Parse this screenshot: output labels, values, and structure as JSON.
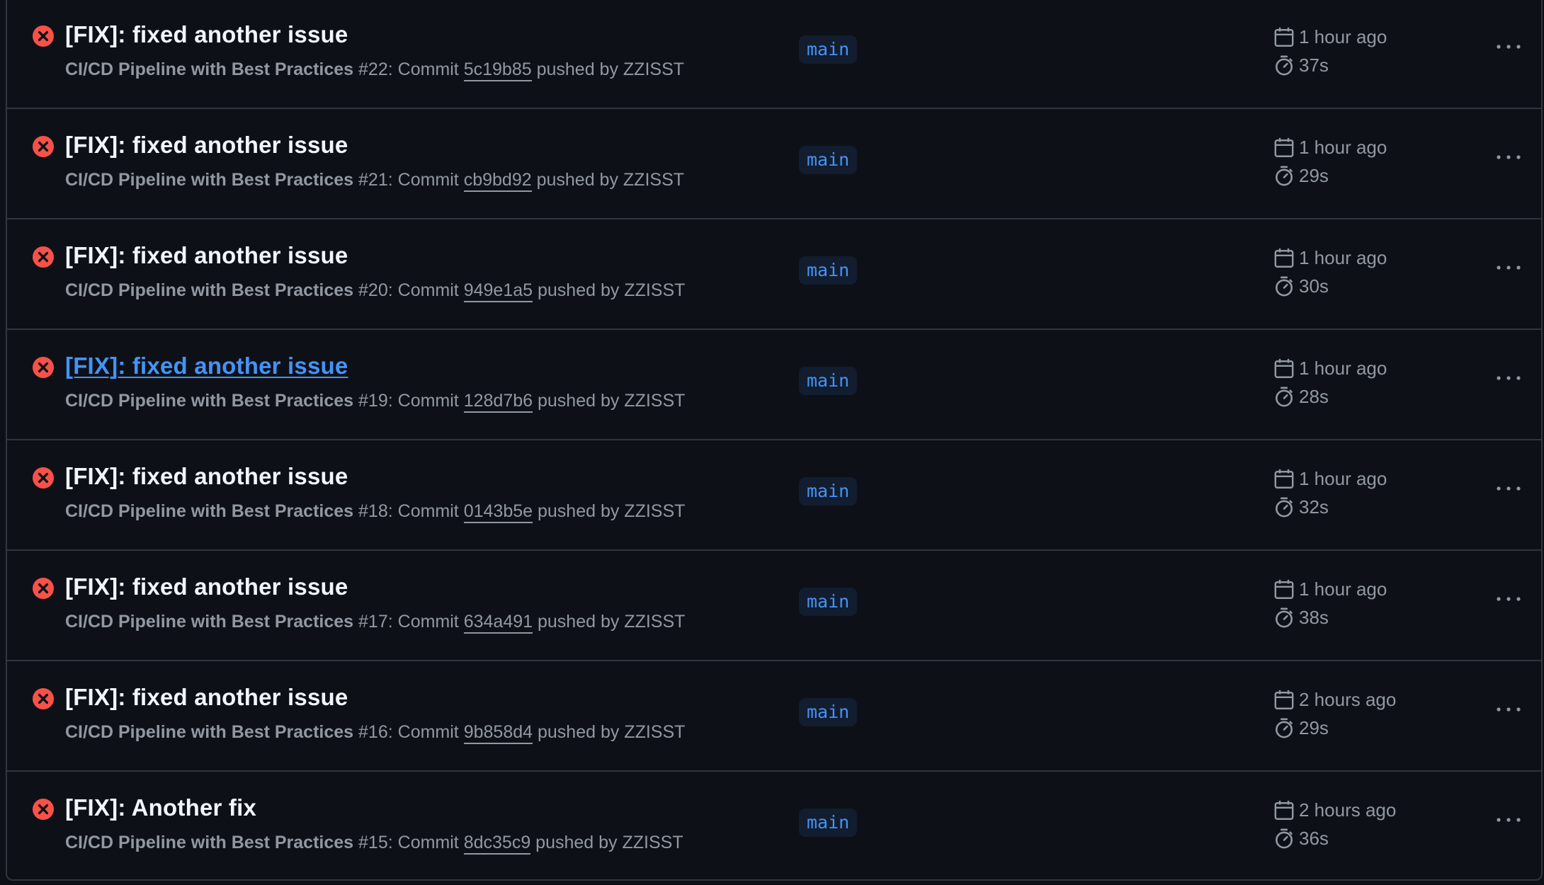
{
  "runs": [
    {
      "title": "[FIX]: fixed another issue",
      "workflow": "CI/CD Pipeline with Best Practices",
      "number": "#22",
      "commit_prefix": ": Commit ",
      "sha": "5c19b85",
      "pushed_by": " pushed by ZZISST",
      "branch": "main",
      "when": "1 hour ago",
      "duration": "37s",
      "status": "failure"
    },
    {
      "title": "[FIX]: fixed another issue",
      "workflow": "CI/CD Pipeline with Best Practices",
      "number": "#21",
      "commit_prefix": ": Commit ",
      "sha": "cb9bd92",
      "pushed_by": " pushed by ZZISST",
      "branch": "main",
      "when": "1 hour ago",
      "duration": "29s",
      "status": "failure"
    },
    {
      "title": "[FIX]: fixed another issue",
      "workflow": "CI/CD Pipeline with Best Practices",
      "number": "#20",
      "commit_prefix": ": Commit ",
      "sha": "949e1a5",
      "pushed_by": " pushed by ZZISST",
      "branch": "main",
      "when": "1 hour ago",
      "duration": "30s",
      "status": "failure"
    },
    {
      "title": "[FIX]: fixed another issue",
      "workflow": "CI/CD Pipeline with Best Practices",
      "number": "#19",
      "commit_prefix": ": Commit ",
      "sha": "128d7b6",
      "pushed_by": " pushed by ZZISST",
      "branch": "main",
      "when": "1 hour ago",
      "duration": "28s",
      "status": "failure"
    },
    {
      "title": "[FIX]: fixed another issue",
      "workflow": "CI/CD Pipeline with Best Practices",
      "number": "#18",
      "commit_prefix": ": Commit ",
      "sha": "0143b5e",
      "pushed_by": " pushed by ZZISST",
      "branch": "main",
      "when": "1 hour ago",
      "duration": "32s",
      "status": "failure"
    },
    {
      "title": "[FIX]: fixed another issue",
      "workflow": "CI/CD Pipeline with Best Practices",
      "number": "#17",
      "commit_prefix": ": Commit ",
      "sha": "634a491",
      "pushed_by": " pushed by ZZISST",
      "branch": "main",
      "when": "1 hour ago",
      "duration": "38s",
      "status": "failure"
    },
    {
      "title": "[FIX]: fixed another issue",
      "workflow": "CI/CD Pipeline with Best Practices",
      "number": "#16",
      "commit_prefix": ": Commit ",
      "sha": "9b858d4",
      "pushed_by": " pushed by ZZISST",
      "branch": "main",
      "when": "2 hours ago",
      "duration": "29s",
      "status": "failure"
    },
    {
      "title": "[FIX]: Another fix",
      "workflow": "CI/CD Pipeline with Best Practices",
      "number": "#15",
      "commit_prefix": ": Commit ",
      "sha": "8dc35c9",
      "pushed_by": " pushed by ZZISST",
      "branch": "main",
      "when": "2 hours ago",
      "duration": "36s",
      "status": "failure"
    }
  ],
  "hovered_run_index": 3,
  "icons": {
    "status": "x-circle-fill-icon",
    "date": "calendar-icon",
    "duration": "stopwatch-icon",
    "more": "kebab-horizontal-icon"
  },
  "colors": {
    "background": "#0d1117",
    "failure": "#f85149",
    "link": "#4493f8",
    "text": "#f0f6fc",
    "muted": "#9198a1",
    "border": "#30363d",
    "branch_bg": "#121d2f"
  }
}
